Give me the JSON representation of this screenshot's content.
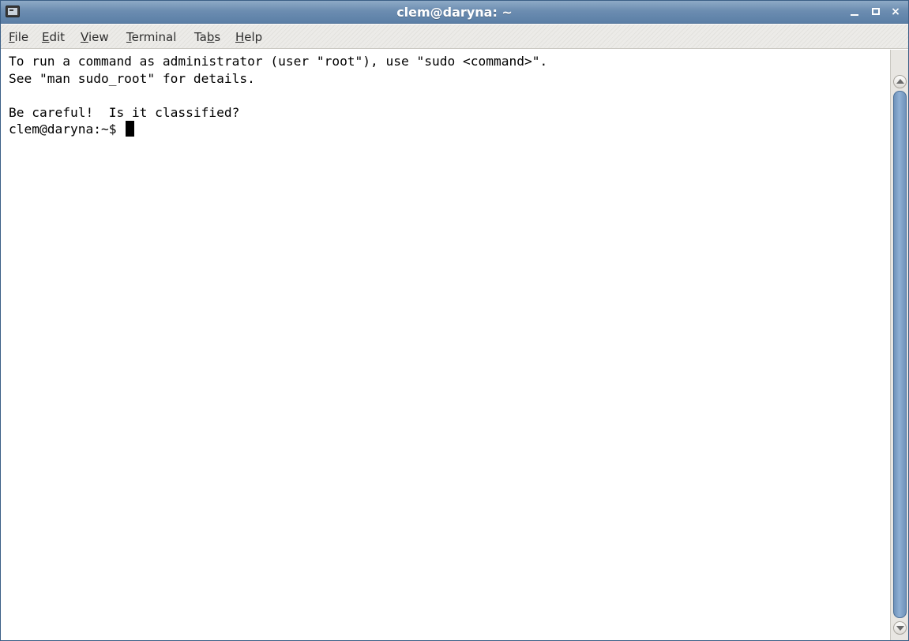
{
  "window": {
    "title": "clem@daryna: ~",
    "app_icon": "terminal-icon",
    "controls": {
      "minimize_icon": "minimize-icon",
      "maximize_icon": "maximize-icon",
      "close_icon": "close-icon",
      "close_glyph": "×"
    }
  },
  "menu": {
    "items": [
      {
        "mnemonic": "F",
        "rest": "ile"
      },
      {
        "mnemonic": "E",
        "rest": "dit"
      },
      {
        "mnemonic": "V",
        "rest": "iew"
      },
      {
        "mnemonic": "T",
        "rest": "erminal"
      },
      {
        "pre": "Ta",
        "mnemonic": "b",
        "rest": "s"
      },
      {
        "mnemonic": "H",
        "rest": "elp"
      }
    ]
  },
  "terminal": {
    "lines": [
      "To run a command as administrator (user \"root\"), use \"sudo <command>\".",
      "See \"man sudo_root\" for details.",
      "",
      "Be careful!  Is it classified?"
    ],
    "prompt": "clem@daryna:~$ "
  },
  "colors": {
    "titlebar": "#6c8db1",
    "terminal_bg": "#ffffff",
    "terminal_fg": "#000000",
    "scroll_thumb": "#7a9cc3"
  }
}
